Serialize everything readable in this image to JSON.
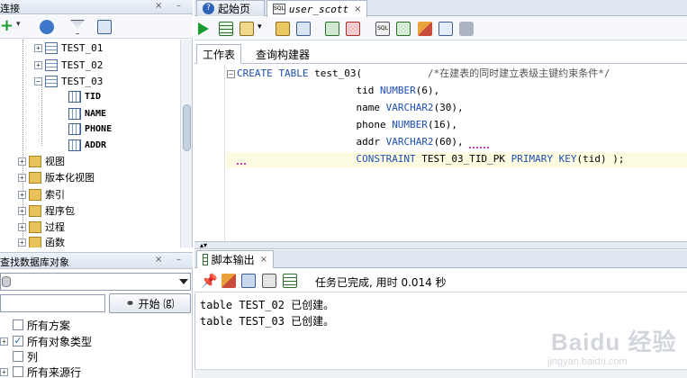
{
  "connections_panel": {
    "title": "连接",
    "tree": [
      {
        "label": "TEST_01",
        "kind": "table"
      },
      {
        "label": "TEST_02",
        "kind": "table"
      },
      {
        "label": "TEST_03",
        "kind": "table"
      },
      {
        "label": "TID",
        "kind": "column"
      },
      {
        "label": "NAME",
        "kind": "column"
      },
      {
        "label": "PHONE",
        "kind": "column"
      },
      {
        "label": "ADDR",
        "kind": "column"
      },
      {
        "label": "视图",
        "kind": "folder"
      },
      {
        "label": "版本化视图",
        "kind": "folder"
      },
      {
        "label": "索引",
        "kind": "folder"
      },
      {
        "label": "程序包",
        "kind": "folder"
      },
      {
        "label": "过程",
        "kind": "folder"
      },
      {
        "label": "函数",
        "kind": "folder"
      }
    ]
  },
  "find_panel": {
    "title": "查找数据库对象",
    "search_value": "",
    "start_label": "开始 ⒢",
    "options": [
      {
        "label": "所有方案",
        "checked": false
      },
      {
        "label": "所有对象类型",
        "checked": true
      },
      {
        "label": "列",
        "checked": false
      },
      {
        "label": "所有来源行",
        "checked": false
      }
    ]
  },
  "editor": {
    "tabs": [
      {
        "label": "起始页",
        "active": false
      },
      {
        "label": "user_scott",
        "active": true
      }
    ],
    "subtabs": [
      "工作表",
      "查询构建器"
    ],
    "code_lines": [
      {
        "parts": [
          [
            "kw",
            "CREATE TABLE"
          ],
          [
            "tx",
            " test_03("
          ],
          [
            "tx",
            "           "
          ],
          [
            "cm",
            "/*在建表的同时建立表级主键约束条件*/"
          ]
        ]
      },
      {
        "parts": [
          [
            "tx",
            "                    tid "
          ],
          [
            "kw",
            "NUMBER"
          ],
          [
            "tx",
            "(6),"
          ]
        ]
      },
      {
        "parts": [
          [
            "tx",
            "                    name "
          ],
          [
            "kw",
            "VARCHAR2"
          ],
          [
            "tx",
            "(30),"
          ]
        ]
      },
      {
        "parts": [
          [
            "tx",
            "                    phone "
          ],
          [
            "kw",
            "NUMBER"
          ],
          [
            "tx",
            "(16),"
          ]
        ]
      },
      {
        "parts": [
          [
            "tx",
            "                    addr "
          ],
          [
            "kw",
            "VARCHAR2"
          ],
          [
            "tx",
            "(60),"
          ]
        ]
      },
      {
        "parts": [
          [
            "tx",
            "                    "
          ],
          [
            "kw",
            "CONSTRAINT"
          ],
          [
            "tx",
            " TEST_03_TID_PK "
          ],
          [
            "kw",
            "PRIMARY KEY"
          ],
          [
            "tx",
            "(tid) );"
          ]
        ]
      }
    ]
  },
  "script_output": {
    "tab_label": "脚本输出",
    "status": "任务已完成, 用时 0.014 秒",
    "lines": [
      "table TEST_02 已创建。",
      "table TEST_03 已创建。"
    ]
  },
  "watermark": {
    "text": "Baidu 经验",
    "sub": "jingyan.baidu.com"
  },
  "colors": {
    "keyword": "#1d4fb3",
    "panel_header": "#dbe4ef",
    "current_line": "#fdfbe0"
  }
}
